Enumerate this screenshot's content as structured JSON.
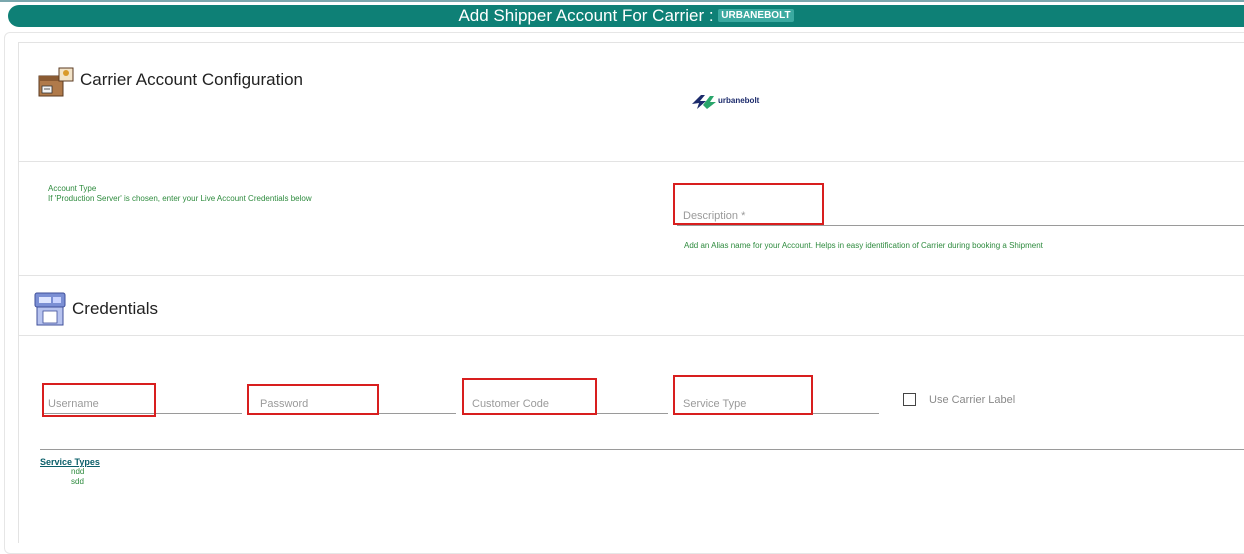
{
  "header": {
    "title": "Add Shipper Account For Carrier :",
    "carrier_badge": "URBANEBOLT"
  },
  "config": {
    "title": "Carrier Account Configuration",
    "icon": "carrier-package-icon",
    "logo_text": "urbanebolt"
  },
  "account_type": {
    "label": "Account Type",
    "hint": "If 'Production Server' is chosen, enter your Live Account Credentials below"
  },
  "description": {
    "placeholder": "Description *",
    "help": "Add an Alias name for your Account. Helps in easy identification of Carrier during booking a Shipment"
  },
  "credentials": {
    "title": "Credentials",
    "icon": "credentials-icon",
    "username_placeholder": "Username",
    "password_placeholder": "Password",
    "customer_code_placeholder": "Customer Code",
    "service_type_placeholder": "Service Type",
    "use_carrier_label": "Use Carrier Label"
  },
  "service_types": {
    "title": "Service Types",
    "items": [
      "ndd",
      "sdd"
    ]
  },
  "colors": {
    "header_bg": "#0e8076",
    "help_text": "#2e8b3e",
    "highlight": "#d81e1e"
  }
}
